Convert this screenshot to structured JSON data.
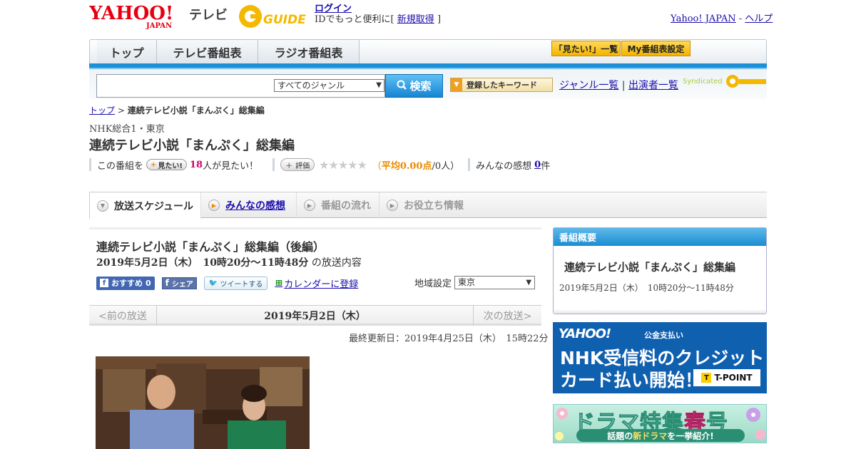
{
  "header": {
    "yahoo_logo": "YAHOO!",
    "yahoo_logo_sub": "JAPAN",
    "tv_label": "テレビ",
    "gguide_logo": "GUIDE",
    "login_link": "ログイン",
    "login_prefix": "IDでもっと便利に[",
    "register_link": "新規取得",
    "login_suffix": "]",
    "yahoo_japan_link": "Yahoo! JAPAN",
    "separator": " - ",
    "help_link": "ヘルプ"
  },
  "nav": {
    "tabs": [
      {
        "label": "トップ"
      },
      {
        "label": "テレビ番組表"
      },
      {
        "label": "ラジオ番組表"
      }
    ],
    "mitai_list": "「見たい!」一覧",
    "my_bangumi": "My番組表設定"
  },
  "search": {
    "input_value": "",
    "genre_selected": "すべてのジャンル",
    "search_button": "検索",
    "keyword_button": "登録したキーワード",
    "genre_list_link": "ジャンル一覧",
    "pipe": "|",
    "performer_list_link": "出演者一覧",
    "syndicated": "Syndicated"
  },
  "breadcrumb": {
    "top": "トップ",
    "sep": " > ",
    "current": "連続テレビ小説「まんぷく」総集編"
  },
  "program": {
    "channel": "NHK総合1・東京",
    "title": "連続テレビ小説「まんぷく」総集編",
    "mitai_prefix": "この番組を",
    "mitai_button": "見たい!",
    "mitai_count": "18",
    "mitai_suffix": "人が見たい！",
    "hyoka_button": "評価",
    "stars": "★★★★★",
    "avg_open": "（",
    "avg_label": "平均0.00点",
    "avg_people": "/0人）",
    "kansou_prefix": "みんなの感想",
    "kansou_count": "0",
    "kansou_suffix": "件"
  },
  "tabs": {
    "schedule": "放送スケジュール",
    "kansou": "みんなの感想",
    "flow": "番組の流れ",
    "info": "お役立ち情報"
  },
  "episode": {
    "title": "連続テレビ小説「まんぷく」総集編（後編）",
    "date": "2019年5月2日（木）　10時20分～11時48分",
    "date_suffix": "の放送内容",
    "recommend": "おすすめ",
    "recommend_count": "0",
    "share": "シェア",
    "tweet": "ツイートする",
    "calendar": "カレンダーに登録",
    "region_label": "地域設定",
    "region_value": "東京",
    "prev": "<前の放送",
    "current_date": "2019年5月2日（木）",
    "next": "次の放送>",
    "updated": "最終更新日：2019年4月25日（木）　15時22分"
  },
  "sidebar": {
    "summary_head": "番組概要",
    "summary_title": "連続テレビ小説「まんぷく」総集編",
    "summary_date": "2019年5月2日（木）　10時20分～11時48分",
    "ad_nhk_logo": "YAHOO!",
    "ad_nhk_tag": "公金支払い",
    "ad_nhk_line1": "NHK受信料のクレジット",
    "ad_nhk_line2": "カード払い開始！",
    "ad_tpoint": "T-POINT",
    "ad_drama_title_a": "ドラマ特集",
    "ad_drama_title_b": "春",
    "ad_drama_title_c": "号",
    "ad_drama_sub_a": "話題の",
    "ad_drama_sub_b": "新ドラマ",
    "ad_drama_sub_c": "を一挙紹介!"
  },
  "colors": {
    "nav_blue": "#1c8fd6",
    "link": "#1a0dab",
    "accent_pink": "#d4006a",
    "accent_orange": "#e88a00"
  }
}
